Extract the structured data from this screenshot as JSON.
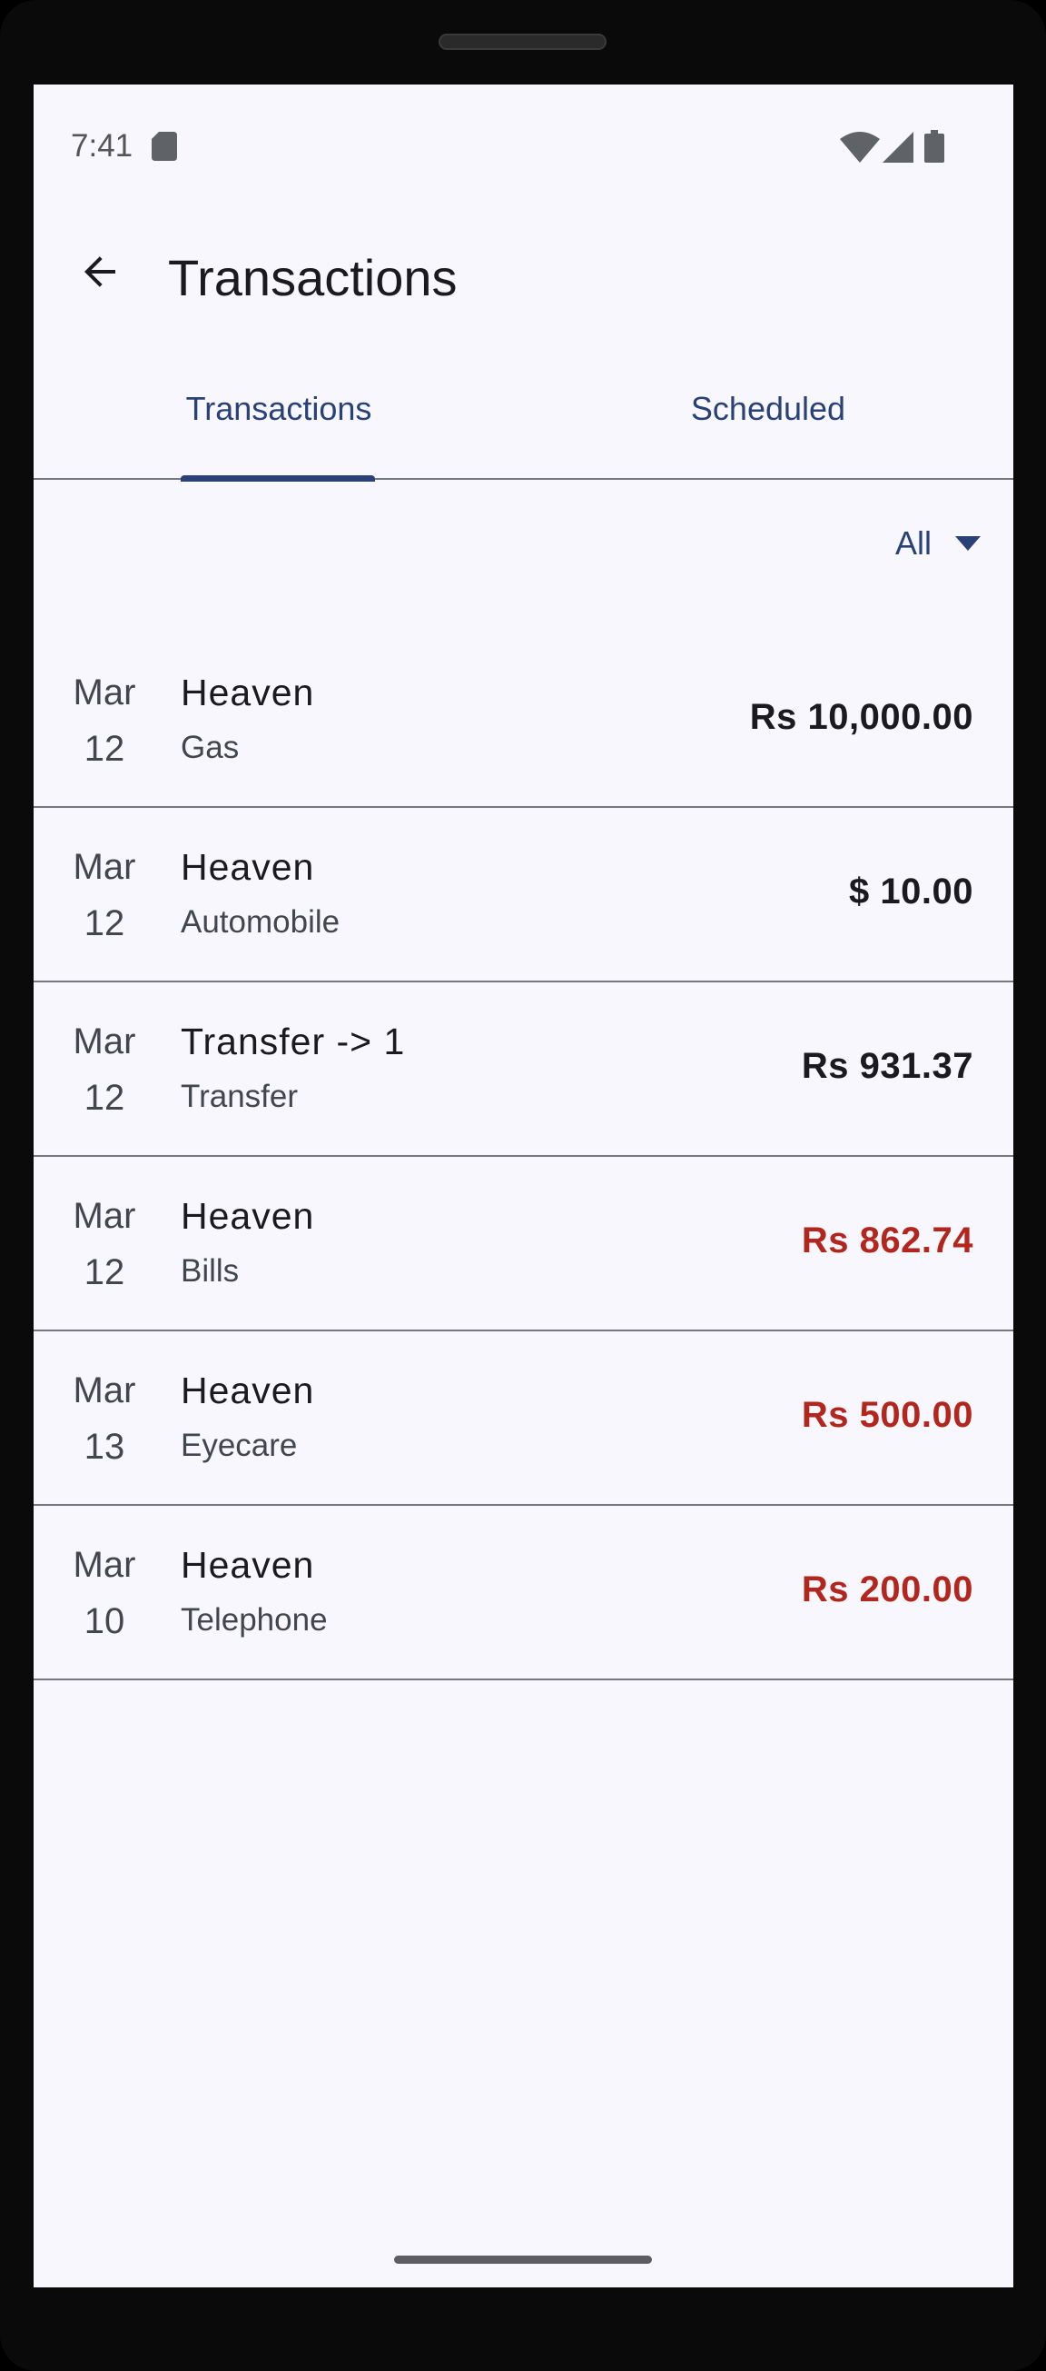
{
  "status_bar": {
    "time": "7:41"
  },
  "app_bar": {
    "title": "Transactions"
  },
  "tabs": [
    {
      "label": "Transactions",
      "selected": true
    },
    {
      "label": "Scheduled",
      "selected": false
    }
  ],
  "filter": {
    "selected": "All"
  },
  "transactions": [
    {
      "month": "Mar",
      "day": "12",
      "payee": "Heaven",
      "category": "Gas",
      "amount": "Rs 10,000.00",
      "type": "neutral"
    },
    {
      "month": "Mar",
      "day": "12",
      "payee": "Heaven",
      "category": "Automobile",
      "amount": "$ 10.00",
      "type": "neutral"
    },
    {
      "month": "Mar",
      "day": "12",
      "payee": "Transfer -> 1",
      "category": "Transfer",
      "amount": "Rs 931.37",
      "type": "neutral"
    },
    {
      "month": "Mar",
      "day": "12",
      "payee": "Heaven",
      "category": "Bills",
      "amount": "Rs 862.74",
      "type": "expense"
    },
    {
      "month": "Mar",
      "day": "13",
      "payee": "Heaven",
      "category": "Eyecare",
      "amount": "Rs 500.00",
      "type": "expense"
    },
    {
      "month": "Mar",
      "day": "10",
      "payee": "Heaven",
      "category": "Telephone",
      "amount": "Rs 200.00",
      "type": "expense"
    }
  ],
  "colors": {
    "accent": "#2a4178",
    "expense": "#b3261e",
    "neutral": "#1b1b1f",
    "background": "#f7f7fd"
  }
}
